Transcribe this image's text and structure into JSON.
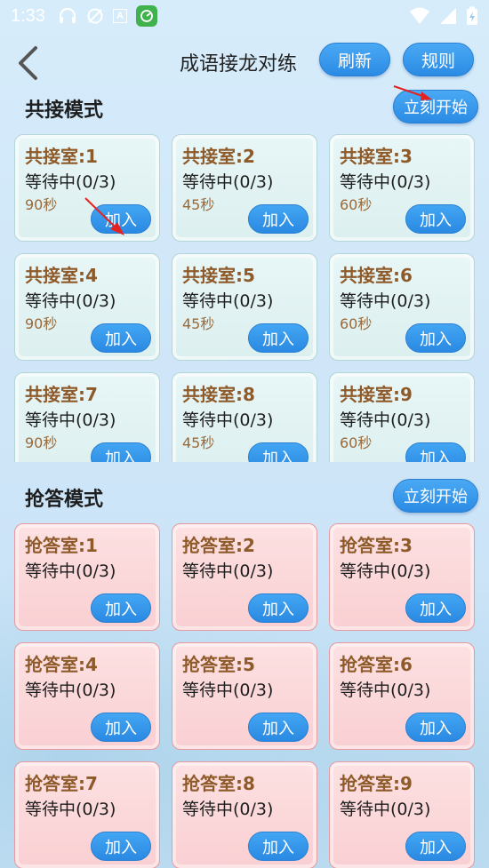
{
  "status_bar": {
    "time": "1:33"
  },
  "header": {
    "title": "成语接龙对练",
    "refresh_label": "刷新",
    "rules_label": "规则"
  },
  "gongjie": {
    "title": "共接模式",
    "start_label": "立刻开始",
    "rooms": [
      {
        "name": "共接室:1",
        "status": "等待中(0/3)",
        "time": "90秒",
        "join": "加入"
      },
      {
        "name": "共接室:2",
        "status": "等待中(0/3)",
        "time": "45秒",
        "join": "加入"
      },
      {
        "name": "共接室:3",
        "status": "等待中(0/3)",
        "time": "60秒",
        "join": "加入"
      },
      {
        "name": "共接室:4",
        "status": "等待中(0/3)",
        "time": "90秒",
        "join": "加入"
      },
      {
        "name": "共接室:5",
        "status": "等待中(0/3)",
        "time": "45秒",
        "join": "加入"
      },
      {
        "name": "共接室:6",
        "status": "等待中(0/3)",
        "time": "60秒",
        "join": "加入"
      },
      {
        "name": "共接室:7",
        "status": "等待中(0/3)",
        "time": "90秒",
        "join": "加入"
      },
      {
        "name": "共接室:8",
        "status": "等待中(0/3)",
        "time": "45秒",
        "join": "加入"
      },
      {
        "name": "共接室:9",
        "status": "等待中(0/3)",
        "time": "60秒",
        "join": "加入"
      }
    ]
  },
  "qiangda": {
    "title": "抢答模式",
    "start_label": "立刻开始",
    "rooms": [
      {
        "name": "抢答室:1",
        "status": "等待中(0/3)",
        "join": "加入"
      },
      {
        "name": "抢答室:2",
        "status": "等待中(0/3)",
        "join": "加入"
      },
      {
        "name": "抢答室:3",
        "status": "等待中(0/3)",
        "join": "加入"
      },
      {
        "name": "抢答室:4",
        "status": "等待中(0/3)",
        "join": "加入"
      },
      {
        "name": "抢答室:5",
        "status": "等待中(0/3)",
        "join": "加入"
      },
      {
        "name": "抢答室:6",
        "status": "等待中(0/3)",
        "join": "加入"
      },
      {
        "name": "抢答室:7",
        "status": "等待中(0/3)",
        "join": "加入"
      },
      {
        "name": "抢答室:8",
        "status": "等待中(0/3)",
        "join": "加入"
      },
      {
        "name": "抢答室:9",
        "status": "等待中(0/3)",
        "join": "加入"
      }
    ]
  }
}
